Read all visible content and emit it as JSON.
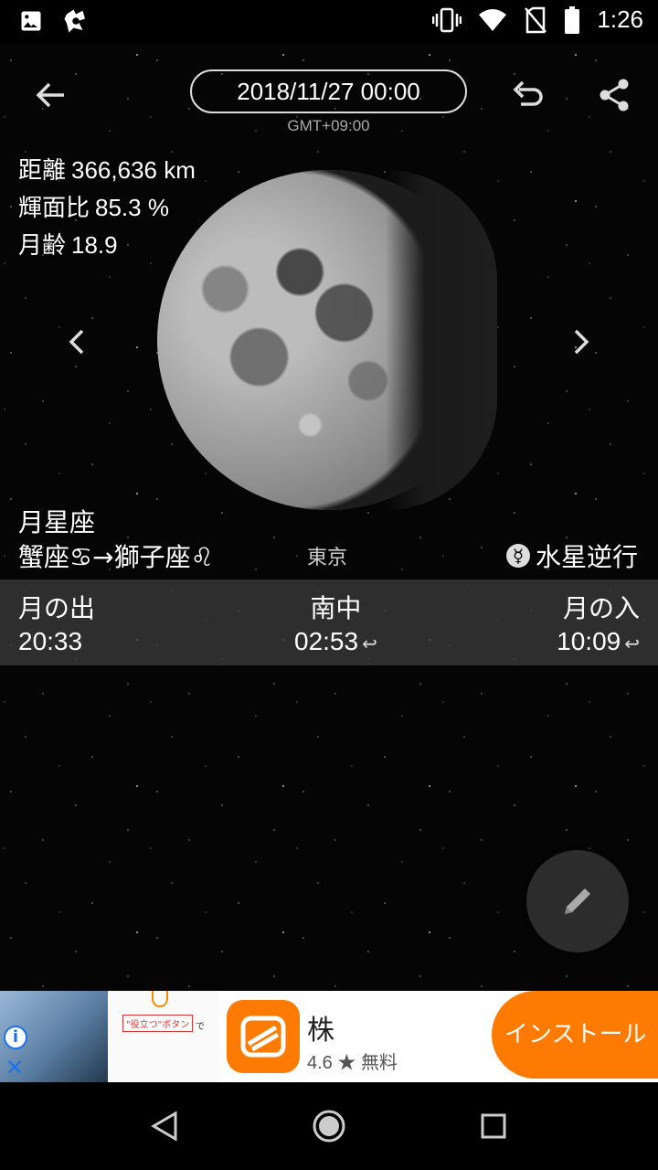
{
  "status_bar": {
    "time": "1:26",
    "icons": [
      "image-icon",
      "app-notify-icon",
      "vibrate-icon",
      "wifi-icon",
      "no-sim-icon",
      "battery-icon"
    ]
  },
  "header": {
    "datetime": "2018/11/27 00:00",
    "timezone": "GMT+09:00"
  },
  "moon_info": {
    "distance_label": "距離",
    "distance_value": "366,636 km",
    "illumination_label": "輝面比",
    "illumination_value": "85.3 %",
    "age_label": "月齢",
    "age_value": "18.9"
  },
  "zodiac": {
    "title": "月星座",
    "from": "蟹座",
    "from_symbol": "♋",
    "arrow": "→",
    "to": "獅子座",
    "to_symbol": "♌"
  },
  "location": "東京",
  "mercury": {
    "symbol": "☿",
    "label": "水星逆行"
  },
  "times": {
    "rise_label": "月の出",
    "rise_value": "20:33",
    "transit_label": "南中",
    "transit_value": "02:53",
    "set_label": "月の入",
    "set_value": "10:09",
    "next_day_symbol": "↩"
  },
  "ad": {
    "banner_text": "\"役立つ\"ボタン",
    "banner_suffix": "で",
    "app_name": "株",
    "rating": "4.6",
    "star": "★",
    "price": "無料",
    "install_label": "インストール"
  },
  "colors": {
    "accent": "#ff7a00",
    "band": "#3c3c3c",
    "fab": "#2c2c2c"
  }
}
